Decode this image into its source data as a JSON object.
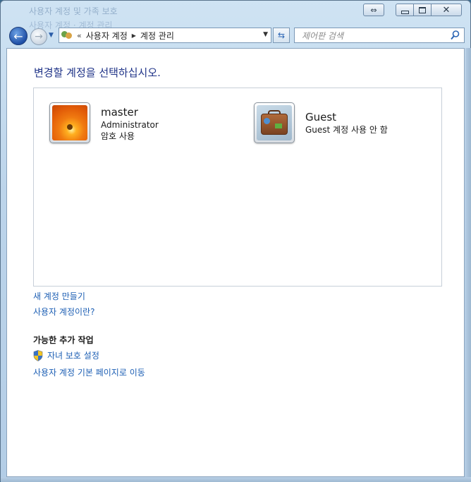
{
  "window": {
    "ghost_title_1": "사용자 계정 및 가족 보호",
    "ghost_title_2": "사용자 계정 · 계정 관리"
  },
  "addressbar": {
    "chevron": "«",
    "crumbs": [
      "사용자 계정",
      "계정 관리"
    ]
  },
  "search": {
    "placeholder": "제어판 검색"
  },
  "main": {
    "title": "변경할 계정을 선택하십시오.",
    "accounts": [
      {
        "name": "master",
        "lines": [
          "Administrator",
          "암호 사용"
        ],
        "avatar": "flower"
      },
      {
        "name": "Guest",
        "lines": [
          "Guest 계정 사용 안 함"
        ],
        "avatar": "suitcase"
      }
    ],
    "links": {
      "create_account": "새 계정 만들기",
      "what_is_account": "사용자 계정이란?"
    },
    "additional": {
      "heading": "가능한 추가 작업",
      "parental_controls": "자녀 보호 설정",
      "go_home": "사용자 계정 기본 페이지로 이동"
    }
  },
  "icons": {
    "nav_back": "arrow-left-icon",
    "nav_forward": "arrow-right-icon",
    "refresh": "refresh-icon",
    "search": "search-icon",
    "shield": "uac-shield-icon"
  }
}
